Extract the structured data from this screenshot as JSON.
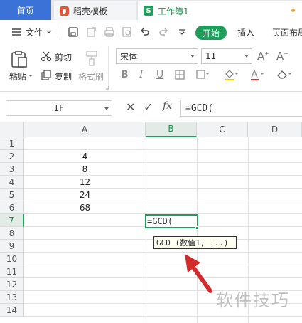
{
  "tabs": {
    "home": "首页",
    "docer": "稻壳模板",
    "book": "工作簿1"
  },
  "menu": {
    "file": "文件",
    "start": "开始",
    "insert": "插入",
    "page_layout": "页面布局"
  },
  "ribbon": {
    "paste": "粘贴",
    "cut": "剪切",
    "copy": "复制",
    "format_painter": "格式刷",
    "font_name": "宋体",
    "font_size": "11",
    "bold": "B",
    "italic": "I",
    "underline": "U"
  },
  "formula_bar": {
    "name_box": "IF",
    "fx": "fx",
    "formula": "=GCD("
  },
  "grid": {
    "columns": [
      "A",
      "B",
      "C",
      "D"
    ],
    "rows": [
      "1",
      "2",
      "3",
      "4",
      "5",
      "6",
      "7",
      "8",
      "9",
      "10",
      "11",
      "12",
      "13",
      "14"
    ],
    "column_a_values": [
      "",
      "4",
      "8",
      "12",
      "24",
      "68"
    ],
    "active_cell_text": "=GCD(",
    "tooltip": "GCD (数值1, ...)"
  },
  "watermark": "软件技巧",
  "colors": {
    "accent_green": "#1e9e5a",
    "tab_blue": "#3b72d8",
    "arrow_red": "#d42c2c"
  }
}
